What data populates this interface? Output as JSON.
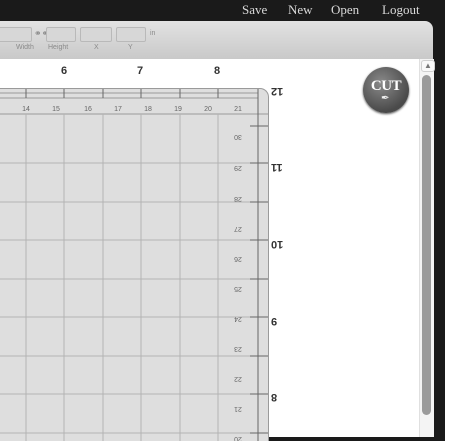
{
  "menu": {
    "items": [
      "Save",
      "New",
      "Open",
      "Logout"
    ]
  },
  "toolbar": {
    "width_label": "Width",
    "height_label": "Height",
    "x_label": "X",
    "y_label": "Y",
    "unit": "in",
    "lock_icon": "chain-link-icon"
  },
  "mat": {
    "top_inches": [
      "6",
      "7",
      "8"
    ],
    "top_cm": [
      "14",
      "15",
      "16",
      "17",
      "18",
      "19",
      "20",
      "21"
    ],
    "side_cm": [
      "30",
      "29",
      "28",
      "27",
      "26",
      "25",
      "24",
      "23",
      "22",
      "21",
      "20"
    ],
    "side_inches": [
      "12",
      "11",
      "10",
      "9",
      "8"
    ]
  },
  "logo": {
    "text": "CUT",
    "icon": "knife-icon"
  },
  "colors": {
    "frame": "#1a1a1a",
    "mat": "#dedede",
    "toolbar": "#d4d4d4",
    "logo": "#5f5f5f"
  }
}
